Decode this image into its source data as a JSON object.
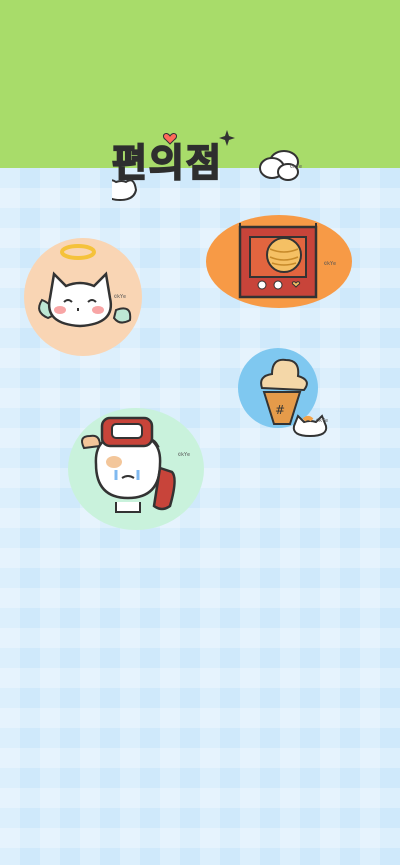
{
  "title": {
    "text": "편의점"
  },
  "watermark": "©kYe",
  "colors": {
    "top_band": "#a8dc6a",
    "background": "#cfe9fb",
    "sticker_angel": "#f9d5b4",
    "sticker_snack": "#f79a46",
    "sticker_icecream": "#7fc8f0",
    "sticker_ramen": "#c9f2dc"
  },
  "stickers": [
    {
      "icon": "angel-cat-icon"
    },
    {
      "icon": "snack-bag-icon"
    },
    {
      "icon": "ice-cream-icon"
    },
    {
      "icon": "ramen-cat-icon"
    }
  ]
}
